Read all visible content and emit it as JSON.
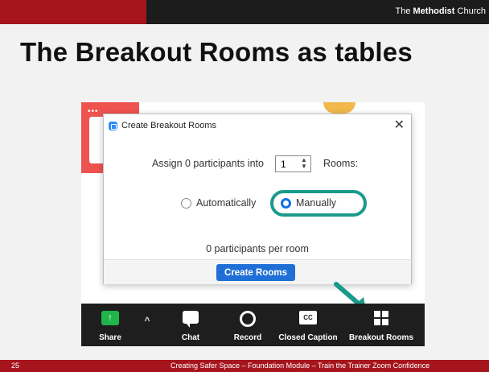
{
  "header": {
    "brand_prefix": "The ",
    "brand_bold": "Methodist",
    "brand_suffix": " Church"
  },
  "slide": {
    "title": "The Breakout Rooms as tables"
  },
  "dialog": {
    "title": "Create Breakout Rooms",
    "close_glyph": "✕",
    "assign_prefix": "Assign 0 participants into",
    "rooms_value": "1",
    "assign_suffix": "Rooms:",
    "option_auto": "Automatically",
    "option_manual": "Manually",
    "selected_option": "Manually",
    "per_room": "0 participants per room",
    "create_button": "Create Rooms"
  },
  "toolbar": {
    "share": "Share",
    "chat": "Chat",
    "record": "Record",
    "cc_icon_text": "CC",
    "closed_caption": "Closed Caption",
    "breakout_rooms": "Breakout Rooms"
  },
  "footer": {
    "slide_number": "25",
    "text": "Creating Safer Space – Foundation Module – Train the Trainer Zoom Confidence"
  },
  "colors": {
    "brand_red": "#a6151c",
    "zoom_blue": "#0e71eb",
    "highlight_teal": "#1a9a8a",
    "share_green": "#20b54a"
  }
}
